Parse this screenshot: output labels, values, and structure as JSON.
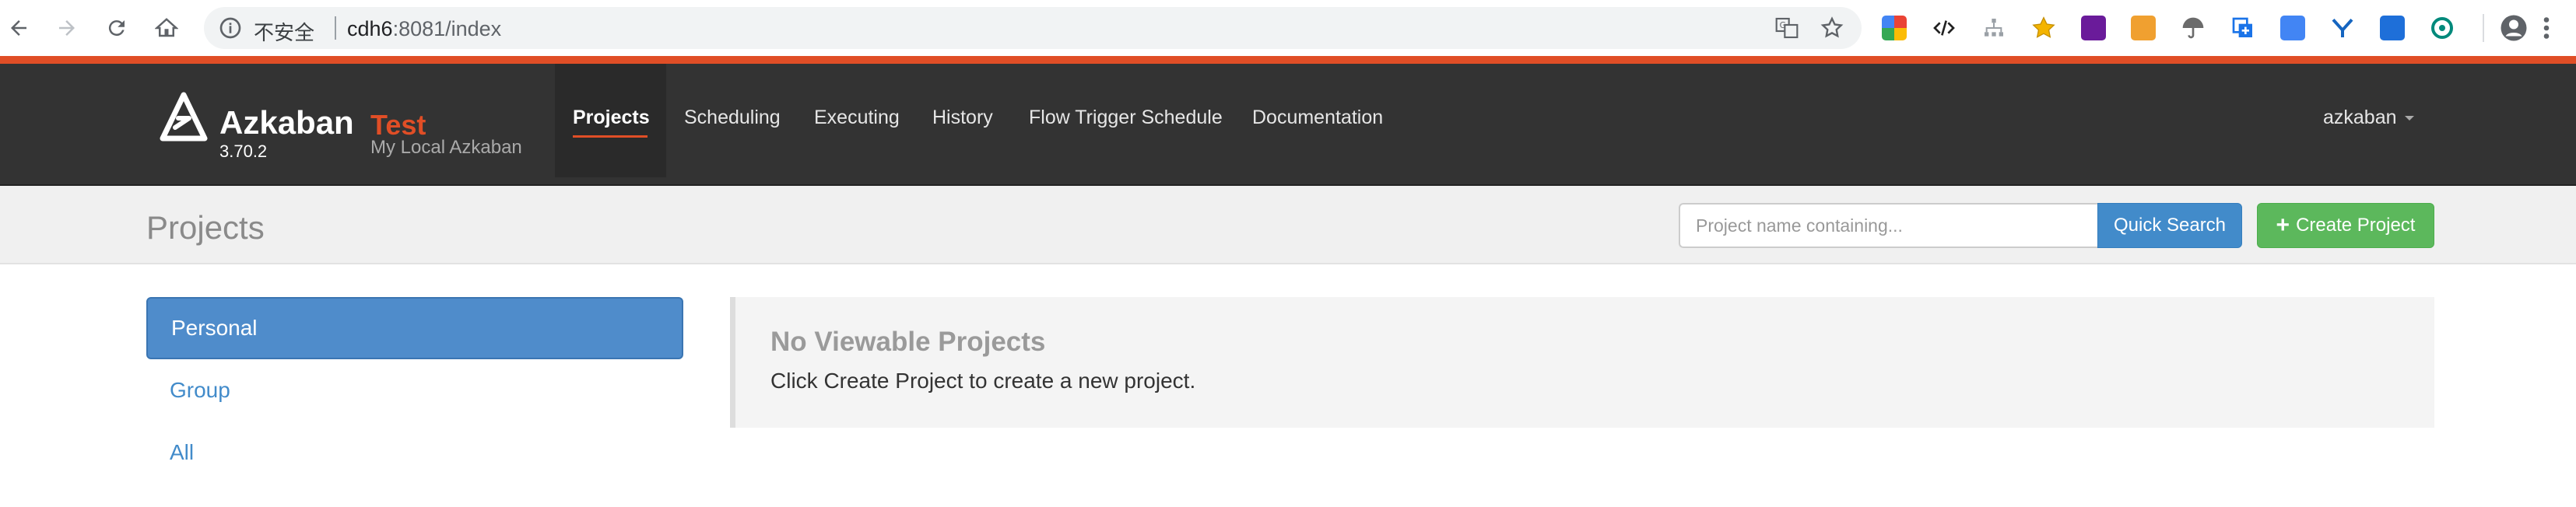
{
  "browser": {
    "security_label": "不安全",
    "url_host": "cdh6",
    "url_rest": ":8081/index"
  },
  "navbar": {
    "brand_name": "Azkaban",
    "brand_env": "Test",
    "version": "3.70.2",
    "subtitle": "My Local Azkaban",
    "links": [
      {
        "label": "Projects",
        "active": true
      },
      {
        "label": "Scheduling",
        "active": false
      },
      {
        "label": "Executing",
        "active": false
      },
      {
        "label": "History",
        "active": false
      },
      {
        "label": "Flow Trigger Schedule",
        "active": false
      },
      {
        "label": "Documentation",
        "active": false
      }
    ],
    "user": "azkaban"
  },
  "header": {
    "title": "Projects",
    "search_placeholder": "Project name containing...",
    "search_button": "Quick Search",
    "create_button": "Create Project",
    "create_icon": "+"
  },
  "sidebar": {
    "items": [
      {
        "label": "Personal",
        "active": true
      },
      {
        "label": "Group",
        "active": false
      },
      {
        "label": "All",
        "active": false
      }
    ]
  },
  "panel": {
    "title": "No Viewable Projects",
    "message": "Click Create Project to create a new project."
  },
  "colors": {
    "accent": "#e04e26",
    "navbar": "#333333",
    "primary": "#428bca",
    "success": "#5cb85c"
  },
  "icons": {
    "browser": [
      "back-icon",
      "forward-icon",
      "reload-icon",
      "home-icon",
      "info-icon",
      "translate-icon",
      "bookmark-star-icon",
      "profile-icon",
      "menu-icon"
    ],
    "brand": "azkaban-logo-icon",
    "create": "plus-icon"
  }
}
